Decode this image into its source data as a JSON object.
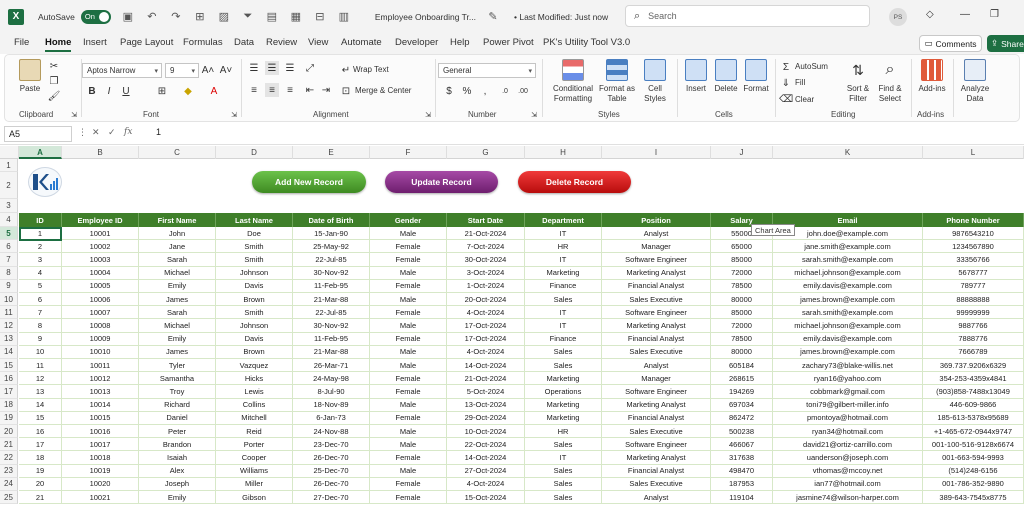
{
  "titlebar": {
    "logo": "X",
    "autosave_label": "AutoSave",
    "autosave_state": "On",
    "document_title": "Employee Onboarding Tr...",
    "modified": "• Last Modified: Just now",
    "search_placeholder": "Search",
    "user_initials": "PS"
  },
  "menu": {
    "tabs": [
      "File",
      "Home",
      "Insert",
      "Page Layout",
      "Formulas",
      "Data",
      "Review",
      "View",
      "Automate",
      "Developer",
      "Help",
      "Power Pivot",
      "PK's Utility Tool V3.0"
    ],
    "active": "Home",
    "comments_label": "Comments",
    "share_label": "Share"
  },
  "ribbon": {
    "clipboard": {
      "paste": "Paste",
      "label": "Clipboard"
    },
    "font": {
      "name": "Aptos Narrow",
      "size": "9",
      "label": "Font",
      "bold": "B",
      "italic": "I",
      "underline": "U"
    },
    "alignment": {
      "wrap_text": "Wrap Text",
      "merge_center": "Merge & Center",
      "label": "Alignment"
    },
    "number": {
      "format": "General",
      "label": "Number"
    },
    "styles": {
      "conditional_1": "Conditional",
      "conditional_2": "Formatting",
      "format_as_1": "Format as",
      "format_as_2": "Table",
      "cell_1": "Cell",
      "cell_2": "Styles",
      "label": "Styles"
    },
    "cells": {
      "insert": "Insert",
      "delete": "Delete",
      "format": "Format",
      "label": "Cells"
    },
    "editing": {
      "autosum": "AutoSum",
      "fill": "Fill",
      "clear": "Clear",
      "sort_1": "Sort &",
      "sort_2": "Filter",
      "find_1": "Find &",
      "find_2": "Select",
      "label": "Editing"
    },
    "addins": {
      "addins": "Add-ins",
      "label": "Add-ins",
      "analyze_1": "Analyze",
      "analyze_2": "Data"
    }
  },
  "formula_bar": {
    "name_box": "A5",
    "fx": "fx",
    "value": "1"
  },
  "columns": [
    "A",
    "B",
    "C",
    "D",
    "E",
    "F",
    "G",
    "H",
    "I",
    "J",
    "K",
    "L"
  ],
  "selected_column": "A",
  "selected_row": "5",
  "buttons": {
    "add": "Add New Record",
    "update": "Update Record",
    "delete": "Delete Record"
  },
  "tooltip": "Chart Area",
  "table": {
    "headers": [
      "ID",
      "Employee ID",
      "First Name",
      "Last Name",
      "Date of Birth",
      "Gender",
      "Start Date",
      "Department",
      "Position",
      "Salary",
      "Email",
      "Phone Number"
    ],
    "rows": [
      [
        "1",
        "10001",
        "John",
        "Doe",
        "15-Jan-90",
        "Male",
        "21-Oct-2024",
        "IT",
        "Analyst",
        "55000",
        "john.doe@example.com",
        "9876543210"
      ],
      [
        "2",
        "10002",
        "Jane",
        "Smith",
        "25-May-92",
        "Female",
        "7-Oct-2024",
        "HR",
        "Manager",
        "65000",
        "jane.smith@example.com",
        "1234567890"
      ],
      [
        "3",
        "10003",
        "Sarah",
        "Smith",
        "22-Jul-85",
        "Female",
        "30-Oct-2024",
        "IT",
        "Software Engineer",
        "85000",
        "sarah.smith@example.com",
        "33356766"
      ],
      [
        "4",
        "10004",
        "Michael",
        "Johnson",
        "30-Nov-92",
        "Male",
        "3-Oct-2024",
        "Marketing",
        "Marketing Analyst",
        "72000",
        "michael.johnson@example.com",
        "5678777"
      ],
      [
        "5",
        "10005",
        "Emily",
        "Davis",
        "11-Feb-95",
        "Female",
        "1-Oct-2024",
        "Finance",
        "Financial Analyst",
        "78500",
        "emily.davis@example.com",
        "789777"
      ],
      [
        "6",
        "10006",
        "James",
        "Brown",
        "21-Mar-88",
        "Male",
        "20-Oct-2024",
        "Sales",
        "Sales Executive",
        "80000",
        "james.brown@example.com",
        "88888888"
      ],
      [
        "7",
        "10007",
        "Sarah",
        "Smith",
        "22-Jul-85",
        "Female",
        "4-Oct-2024",
        "IT",
        "Software Engineer",
        "85000",
        "sarah.smith@example.com",
        "99999999"
      ],
      [
        "8",
        "10008",
        "Michael",
        "Johnson",
        "30-Nov-92",
        "Male",
        "17-Oct-2024",
        "IT",
        "Marketing Analyst",
        "72000",
        "michael.johnson@example.com",
        "9887766"
      ],
      [
        "9",
        "10009",
        "Emily",
        "Davis",
        "11-Feb-95",
        "Female",
        "17-Oct-2024",
        "Finance",
        "Financial Analyst",
        "78500",
        "emily.davis@example.com",
        "7888776"
      ],
      [
        "10",
        "10010",
        "James",
        "Brown",
        "21-Mar-88",
        "Male",
        "4-Oct-2024",
        "Sales",
        "Sales Executive",
        "80000",
        "james.brown@example.com",
        "7666789"
      ],
      [
        "11",
        "10011",
        "Tyler",
        "Vazquez",
        "26-Mar-71",
        "Male",
        "14-Oct-2024",
        "Sales",
        "Analyst",
        "605184",
        "zachary73@blake-willis.net",
        "369.737.9206x6329"
      ],
      [
        "12",
        "10012",
        "Samantha",
        "Hicks",
        "24-May-98",
        "Female",
        "21-Oct-2024",
        "Marketing",
        "Manager",
        "268615",
        "ryan16@yahoo.com",
        "354-253-4359x4841"
      ],
      [
        "13",
        "10013",
        "Troy",
        "Lewis",
        "8-Jul-90",
        "Female",
        "5-Oct-2024",
        "Operations",
        "Software Engineer",
        "194269",
        "cobbmark@gmail.com",
        "(903)858-7488x13049"
      ],
      [
        "14",
        "10014",
        "Richard",
        "Collins",
        "18-Nov-89",
        "Male",
        "13-Oct-2024",
        "Marketing",
        "Marketing Analyst",
        "697034",
        "toni79@gilbert-miller.info",
        "446-609-9866"
      ],
      [
        "15",
        "10015",
        "Daniel",
        "Mitchell",
        "6-Jan-73",
        "Female",
        "29-Oct-2024",
        "Marketing",
        "Financial Analyst",
        "862472",
        "pmontoya@hotmail.com",
        "185-613-5378x95689"
      ],
      [
        "16",
        "10016",
        "Peter",
        "Reid",
        "24-Nov-88",
        "Male",
        "10-Oct-2024",
        "HR",
        "Sales Executive",
        "500238",
        "ryan34@hotmail.com",
        "+1-465-672-0944x9747"
      ],
      [
        "17",
        "10017",
        "Brandon",
        "Porter",
        "23-Dec-70",
        "Male",
        "22-Oct-2024",
        "Sales",
        "Software Engineer",
        "466067",
        "david21@ortiz-carrillo.com",
        "001-100-516-9128x6674"
      ],
      [
        "18",
        "10018",
        "Isaiah",
        "Cooper",
        "26-Dec-70",
        "Female",
        "14-Oct-2024",
        "IT",
        "Marketing Analyst",
        "317638",
        "uanderson@joseph.com",
        "001-663-594-9993"
      ],
      [
        "19",
        "10019",
        "Alex",
        "Williams",
        "25-Dec-70",
        "Male",
        "27-Oct-2024",
        "Sales",
        "Financial Analyst",
        "498470",
        "vthomas@mccoy.net",
        "(514)248-6156"
      ],
      [
        "20",
        "10020",
        "Joseph",
        "Miller",
        "26-Dec-70",
        "Female",
        "4-Oct-2024",
        "Sales",
        "Sales Executive",
        "187953",
        "ian77@hotmail.com",
        "001-786-352-9890"
      ],
      [
        "21",
        "10021",
        "Emily",
        "Gibson",
        "27-Dec-70",
        "Female",
        "15-Oct-2024",
        "Sales",
        "Analyst",
        "119104",
        "jasmine74@wilson-harper.com",
        "389-643-7545x8775"
      ]
    ]
  },
  "colors": {
    "excel_green": "#1d6f42",
    "header_green": "#3f7f2a",
    "btn_add": "#4a9a2a",
    "btn_update": "#8a2a8a",
    "btn_delete": "#d31313"
  }
}
